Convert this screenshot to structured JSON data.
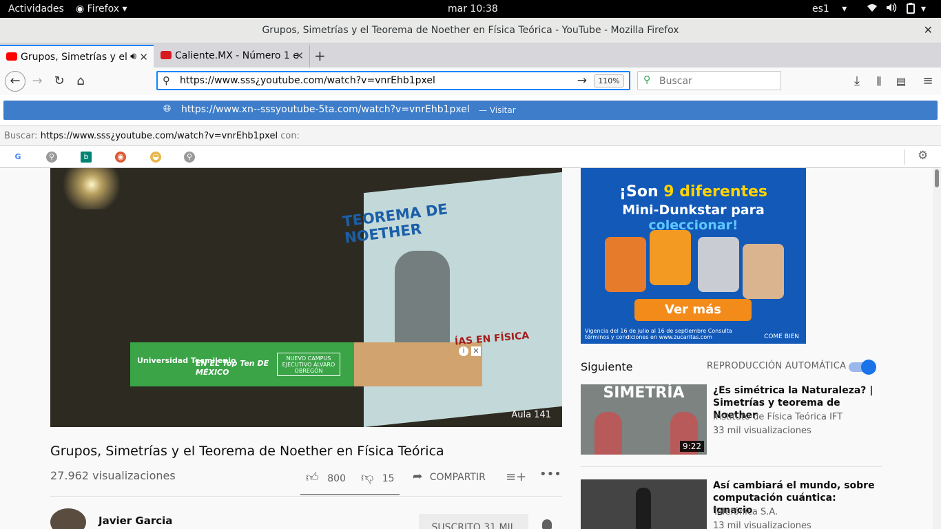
{
  "system_bar": {
    "activities": "Actividades",
    "app_menu": "Firefox",
    "clock": "mar 10:38",
    "keyboard_layout": "es1"
  },
  "window": {
    "title": "Grupos, Simetrías y el Teorema de Noether en Física Teórica - YouTube - Mozilla Firefox"
  },
  "tabs": [
    {
      "label": "Grupos, Simetrías y el T",
      "icon": "youtube-icon",
      "color": "#ff0000",
      "active": true
    },
    {
      "label": "Caliente.MX - Número 1 e",
      "icon": "caliente-icon",
      "color": "#d71920",
      "active": false
    }
  ],
  "toolbar": {
    "url": "https://www.sss¿youtube.com/watch?v=vnrEhb1pxel",
    "zoom": "110%",
    "search_placeholder": "Buscar"
  },
  "suggestion": {
    "url": "https://www.xn--sssyoutube-5ta.com/watch?v=vnrEhb1pxel",
    "action": "— Visitar",
    "search_prefix": "Buscar:",
    "search_query": "https://www.sss¿youtube.com/watch?v=vnrEhb1pxel",
    "search_suffix": "con:"
  },
  "video": {
    "slide_title": "TEOREMA DE NOETHER",
    "slide_subtitle": "ÍAS EN FÍSICA",
    "watermark": "Aula 141",
    "ad": {
      "brand": "Universidad Tecmilenio",
      "tagline": "EN EL Top Ten DE MÉXICO",
      "campus": "NUEVO CAMPUS EJECUTIVO ÁLVARO OBREGÓN"
    },
    "title": "Grupos, Simetrías y el Teorema de Noether en Física Teórica",
    "views": "27.962 visualizaciones",
    "likes": "800",
    "dislikes": "15",
    "share": "COMPARTIR",
    "channel": "Javier Garcia",
    "subscribe": "SUSCRITO  31 MIL"
  },
  "sidebar": {
    "ad": {
      "line1_pre": "¡Son ",
      "line1_hl": "9 diferentes",
      "line2_pre": "Mini-Dunkstar para ",
      "line2_hl": "coleccionar!",
      "cta": "Ver más",
      "legal": "Vigencia del 16 de julio al 16 de septiembre Consulta términos y condiciones en www.zucaritas.com",
      "badge": "COME BIEN"
    },
    "next_label": "Siguiente",
    "autoplay_label": "REPRODUCCIÓN AUTOMÁTICA",
    "autoplay_on": true,
    "recommendations": [
      {
        "title": "¿Es simétrica la Naturaleza? | Simetrías y teorema de Noether",
        "channel": "Instituto de Física Teórica IFT",
        "views": "33 mil visualizaciones",
        "duration": "9:22",
        "thumb_text": "SIMETRÍA"
      },
      {
        "title": "Así cambiará el mundo, sobre computación cuántica: Ignacio",
        "channel": "Telefónica S.A.",
        "views": "13 mil visualizaciones",
        "duration": ""
      }
    ]
  }
}
